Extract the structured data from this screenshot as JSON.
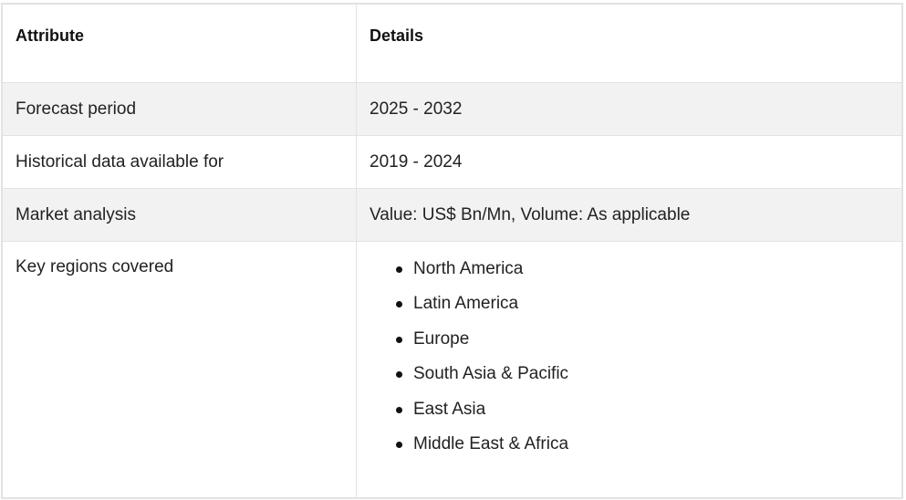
{
  "table": {
    "headers": [
      "Attribute",
      "Details"
    ],
    "rows": [
      {
        "attribute": "Forecast period",
        "details": "2025 - 2032"
      },
      {
        "attribute": "Historical data available for",
        "details": "2019 - 2024"
      },
      {
        "attribute": "Market analysis",
        "details": "Value: US$ Bn/Mn, Volume: As applicable"
      }
    ],
    "regions_row": {
      "attribute": "Key regions covered",
      "items": [
        "North America",
        "Latin America",
        "Europe",
        "South Asia & Pacific",
        "East Asia",
        "Middle East & Africa"
      ]
    }
  }
}
